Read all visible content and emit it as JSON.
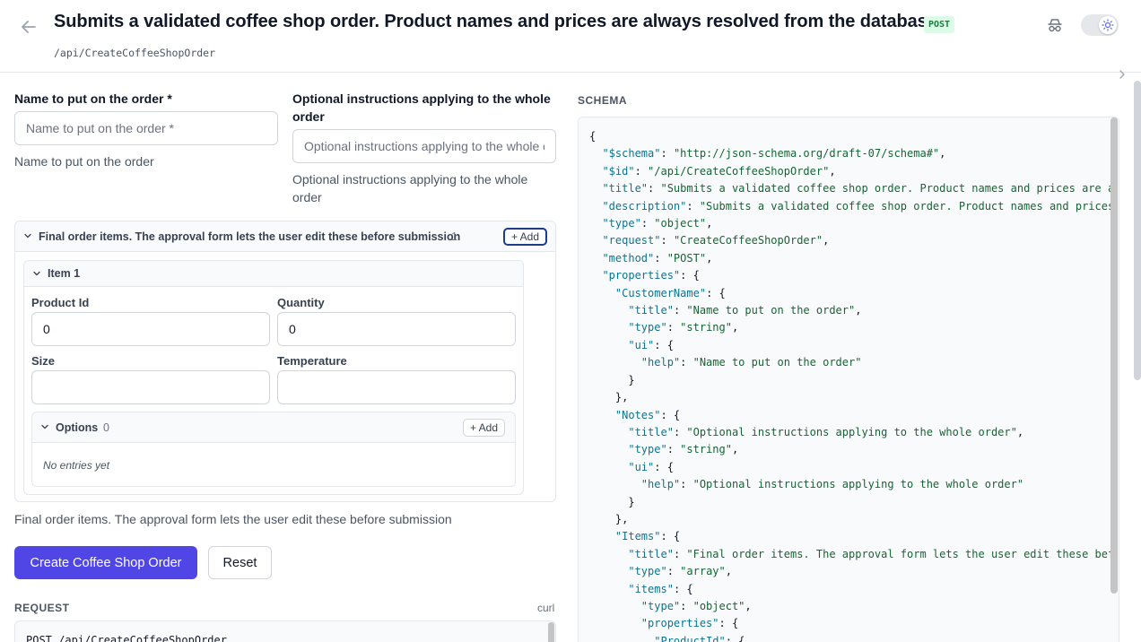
{
  "header": {
    "title": "Submits a validated coffee shop order. Product names and prices are always resolved from the database",
    "method": "POST",
    "path": "/api/CreateCoffeeShopOrder"
  },
  "form": {
    "customer_name": {
      "label": "Name to put on the order *",
      "placeholder": "Name to put on the order *",
      "value": "",
      "help": "Name to put on the order"
    },
    "notes": {
      "label": "Optional instructions applying to the whole order",
      "placeholder": "Optional instructions applying to the whole order",
      "value": "",
      "help": "Optional instructions applying to the whole order"
    },
    "items": {
      "title": "Final order items. The approval form lets the user edit these before submission",
      "count": "1",
      "add_label": "+ Add",
      "help": "Final order items. The approval form lets the user edit these before submission",
      "entries": [
        {
          "title": "Item 1",
          "product_id": {
            "label": "Product Id",
            "value": "0"
          },
          "quantity": {
            "label": "Quantity",
            "value": "0"
          },
          "size": {
            "label": "Size",
            "value": ""
          },
          "temperature": {
            "label": "Temperature",
            "value": ""
          },
          "options": {
            "label": "Options",
            "count": "0",
            "add_label": "+ Add",
            "empty": "No entries yet"
          }
        }
      ]
    },
    "submit_label": "Create Coffee Shop Order",
    "reset_label": "Reset"
  },
  "request": {
    "label": "REQUEST",
    "curl_label": "curl",
    "line": "POST /api/CreateCoffeeShopOrder"
  },
  "schema": {
    "label": "SCHEMA",
    "lines": [
      [
        [
          "p",
          "{"
        ]
      ],
      [
        [
          "p",
          "  "
        ],
        [
          "k",
          "\"$schema\""
        ],
        [
          "p",
          ": "
        ],
        [
          "s",
          "\"http://json-schema.org/draft-07/schema#\""
        ],
        [
          "p",
          ","
        ]
      ],
      [
        [
          "p",
          "  "
        ],
        [
          "k",
          "\"$id\""
        ],
        [
          "p",
          ": "
        ],
        [
          "s",
          "\"/api/CreateCoffeeShopOrder\""
        ],
        [
          "p",
          ","
        ]
      ],
      [
        [
          "p",
          "  "
        ],
        [
          "k",
          "\"title\""
        ],
        [
          "p",
          ": "
        ],
        [
          "s",
          "\"Submits a validated coffee shop order. Product names and prices are a"
        ]
      ],
      [
        [
          "p",
          "  "
        ],
        [
          "k",
          "\"description\""
        ],
        [
          "p",
          ": "
        ],
        [
          "s",
          "\"Submits a validated coffee shop order. Product names and prices"
        ]
      ],
      [
        [
          "p",
          "  "
        ],
        [
          "k",
          "\"type\""
        ],
        [
          "p",
          ": "
        ],
        [
          "s",
          "\"object\""
        ],
        [
          "p",
          ","
        ]
      ],
      [
        [
          "p",
          "  "
        ],
        [
          "k",
          "\"request\""
        ],
        [
          "p",
          ": "
        ],
        [
          "s",
          "\"CreateCoffeeShopOrder\""
        ],
        [
          "p",
          ","
        ]
      ],
      [
        [
          "p",
          "  "
        ],
        [
          "k",
          "\"method\""
        ],
        [
          "p",
          ": "
        ],
        [
          "s",
          "\"POST\""
        ],
        [
          "p",
          ","
        ]
      ],
      [
        [
          "p",
          "  "
        ],
        [
          "k",
          "\"properties\""
        ],
        [
          "p",
          ": {"
        ]
      ],
      [
        [
          "p",
          "    "
        ],
        [
          "k",
          "\"CustomerName\""
        ],
        [
          "p",
          ": {"
        ]
      ],
      [
        [
          "p",
          "      "
        ],
        [
          "k",
          "\"title\""
        ],
        [
          "p",
          ": "
        ],
        [
          "s",
          "\"Name to put on the order\""
        ],
        [
          "p",
          ","
        ]
      ],
      [
        [
          "p",
          "      "
        ],
        [
          "k",
          "\"type\""
        ],
        [
          "p",
          ": "
        ],
        [
          "s",
          "\"string\""
        ],
        [
          "p",
          ","
        ]
      ],
      [
        [
          "p",
          "      "
        ],
        [
          "k",
          "\"ui\""
        ],
        [
          "p",
          ": {"
        ]
      ],
      [
        [
          "p",
          "        "
        ],
        [
          "k",
          "\"help\""
        ],
        [
          "p",
          ": "
        ],
        [
          "s",
          "\"Name to put on the order\""
        ]
      ],
      [
        [
          "p",
          "      }"
        ]
      ],
      [
        [
          "p",
          "    },"
        ]
      ],
      [
        [
          "p",
          "    "
        ],
        [
          "k",
          "\"Notes\""
        ],
        [
          "p",
          ": {"
        ]
      ],
      [
        [
          "p",
          "      "
        ],
        [
          "k",
          "\"title\""
        ],
        [
          "p",
          ": "
        ],
        [
          "s",
          "\"Optional instructions applying to the whole order\""
        ],
        [
          "p",
          ","
        ]
      ],
      [
        [
          "p",
          "      "
        ],
        [
          "k",
          "\"type\""
        ],
        [
          "p",
          ": "
        ],
        [
          "s",
          "\"string\""
        ],
        [
          "p",
          ","
        ]
      ],
      [
        [
          "p",
          "      "
        ],
        [
          "k",
          "\"ui\""
        ],
        [
          "p",
          ": {"
        ]
      ],
      [
        [
          "p",
          "        "
        ],
        [
          "k",
          "\"help\""
        ],
        [
          "p",
          ": "
        ],
        [
          "s",
          "\"Optional instructions applying to the whole order\""
        ]
      ],
      [
        [
          "p",
          "      }"
        ]
      ],
      [
        [
          "p",
          "    },"
        ]
      ],
      [
        [
          "p",
          "    "
        ],
        [
          "k",
          "\"Items\""
        ],
        [
          "p",
          ": {"
        ]
      ],
      [
        [
          "p",
          "      "
        ],
        [
          "k",
          "\"title\""
        ],
        [
          "p",
          ": "
        ],
        [
          "s",
          "\"Final order items. The approval form lets the user edit these bef"
        ]
      ],
      [
        [
          "p",
          "      "
        ],
        [
          "k",
          "\"type\""
        ],
        [
          "p",
          ": "
        ],
        [
          "s",
          "\"array\""
        ],
        [
          "p",
          ","
        ]
      ],
      [
        [
          "p",
          "      "
        ],
        [
          "k",
          "\"items\""
        ],
        [
          "p",
          ": {"
        ]
      ],
      [
        [
          "p",
          "        "
        ],
        [
          "k",
          "\"type\""
        ],
        [
          "p",
          ": "
        ],
        [
          "s",
          "\"object\""
        ],
        [
          "p",
          ","
        ]
      ],
      [
        [
          "p",
          "        "
        ],
        [
          "k",
          "\"properties\""
        ],
        [
          "p",
          ": {"
        ]
      ],
      [
        [
          "p",
          "          "
        ],
        [
          "k",
          "\"ProductId\""
        ],
        [
          "p",
          ": {"
        ]
      ]
    ]
  },
  "colors": {
    "accent": "#4f46e5",
    "post_badge_bg": "#dcfce7",
    "post_badge_text": "#15803d",
    "json_key": "#0e7490",
    "json_string": "#166534"
  },
  "icons": [
    "back-arrow-icon",
    "incognito-icon",
    "sun-icon",
    "chevron-right-icon",
    "chevron-down-icon"
  ]
}
